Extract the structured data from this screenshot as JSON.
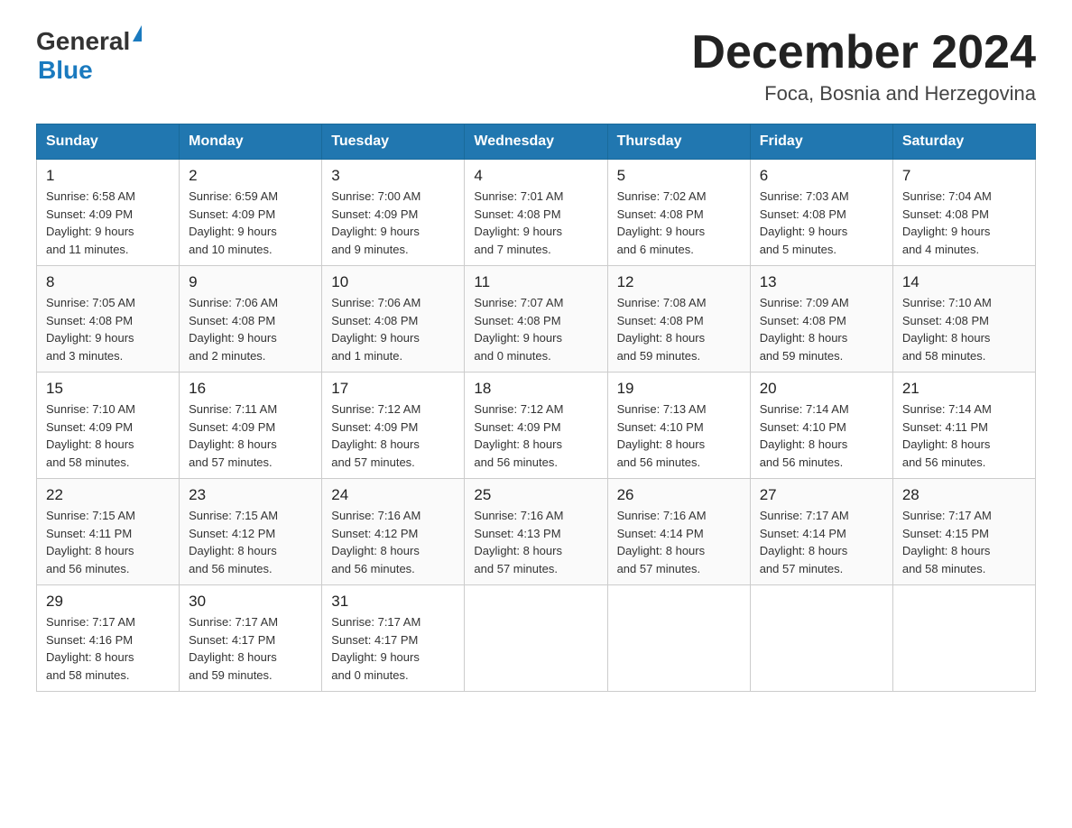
{
  "header": {
    "logo_general": "General",
    "logo_blue": "Blue",
    "month_title": "December 2024",
    "location": "Foca, Bosnia and Herzegovina"
  },
  "weekdays": [
    "Sunday",
    "Monday",
    "Tuesday",
    "Wednesday",
    "Thursday",
    "Friday",
    "Saturday"
  ],
  "weeks": [
    [
      {
        "day": "1",
        "sunrise": "6:58 AM",
        "sunset": "4:09 PM",
        "daylight": "9 hours and 11 minutes."
      },
      {
        "day": "2",
        "sunrise": "6:59 AM",
        "sunset": "4:09 PM",
        "daylight": "9 hours and 10 minutes."
      },
      {
        "day": "3",
        "sunrise": "7:00 AM",
        "sunset": "4:09 PM",
        "daylight": "9 hours and 9 minutes."
      },
      {
        "day": "4",
        "sunrise": "7:01 AM",
        "sunset": "4:08 PM",
        "daylight": "9 hours and 7 minutes."
      },
      {
        "day": "5",
        "sunrise": "7:02 AM",
        "sunset": "4:08 PM",
        "daylight": "9 hours and 6 minutes."
      },
      {
        "day": "6",
        "sunrise": "7:03 AM",
        "sunset": "4:08 PM",
        "daylight": "9 hours and 5 minutes."
      },
      {
        "day": "7",
        "sunrise": "7:04 AM",
        "sunset": "4:08 PM",
        "daylight": "9 hours and 4 minutes."
      }
    ],
    [
      {
        "day": "8",
        "sunrise": "7:05 AM",
        "sunset": "4:08 PM",
        "daylight": "9 hours and 3 minutes."
      },
      {
        "day": "9",
        "sunrise": "7:06 AM",
        "sunset": "4:08 PM",
        "daylight": "9 hours and 2 minutes."
      },
      {
        "day": "10",
        "sunrise": "7:06 AM",
        "sunset": "4:08 PM",
        "daylight": "9 hours and 1 minute."
      },
      {
        "day": "11",
        "sunrise": "7:07 AM",
        "sunset": "4:08 PM",
        "daylight": "9 hours and 0 minutes."
      },
      {
        "day": "12",
        "sunrise": "7:08 AM",
        "sunset": "4:08 PM",
        "daylight": "8 hours and 59 minutes."
      },
      {
        "day": "13",
        "sunrise": "7:09 AM",
        "sunset": "4:08 PM",
        "daylight": "8 hours and 59 minutes."
      },
      {
        "day": "14",
        "sunrise": "7:10 AM",
        "sunset": "4:08 PM",
        "daylight": "8 hours and 58 minutes."
      }
    ],
    [
      {
        "day": "15",
        "sunrise": "7:10 AM",
        "sunset": "4:09 PM",
        "daylight": "8 hours and 58 minutes."
      },
      {
        "day": "16",
        "sunrise": "7:11 AM",
        "sunset": "4:09 PM",
        "daylight": "8 hours and 57 minutes."
      },
      {
        "day": "17",
        "sunrise": "7:12 AM",
        "sunset": "4:09 PM",
        "daylight": "8 hours and 57 minutes."
      },
      {
        "day": "18",
        "sunrise": "7:12 AM",
        "sunset": "4:09 PM",
        "daylight": "8 hours and 56 minutes."
      },
      {
        "day": "19",
        "sunrise": "7:13 AM",
        "sunset": "4:10 PM",
        "daylight": "8 hours and 56 minutes."
      },
      {
        "day": "20",
        "sunrise": "7:14 AM",
        "sunset": "4:10 PM",
        "daylight": "8 hours and 56 minutes."
      },
      {
        "day": "21",
        "sunrise": "7:14 AM",
        "sunset": "4:11 PM",
        "daylight": "8 hours and 56 minutes."
      }
    ],
    [
      {
        "day": "22",
        "sunrise": "7:15 AM",
        "sunset": "4:11 PM",
        "daylight": "8 hours and 56 minutes."
      },
      {
        "day": "23",
        "sunrise": "7:15 AM",
        "sunset": "4:12 PM",
        "daylight": "8 hours and 56 minutes."
      },
      {
        "day": "24",
        "sunrise": "7:16 AM",
        "sunset": "4:12 PM",
        "daylight": "8 hours and 56 minutes."
      },
      {
        "day": "25",
        "sunrise": "7:16 AM",
        "sunset": "4:13 PM",
        "daylight": "8 hours and 57 minutes."
      },
      {
        "day": "26",
        "sunrise": "7:16 AM",
        "sunset": "4:14 PM",
        "daylight": "8 hours and 57 minutes."
      },
      {
        "day": "27",
        "sunrise": "7:17 AM",
        "sunset": "4:14 PM",
        "daylight": "8 hours and 57 minutes."
      },
      {
        "day": "28",
        "sunrise": "7:17 AM",
        "sunset": "4:15 PM",
        "daylight": "8 hours and 58 minutes."
      }
    ],
    [
      {
        "day": "29",
        "sunrise": "7:17 AM",
        "sunset": "4:16 PM",
        "daylight": "8 hours and 58 minutes."
      },
      {
        "day": "30",
        "sunrise": "7:17 AM",
        "sunset": "4:17 PM",
        "daylight": "8 hours and 59 minutes."
      },
      {
        "day": "31",
        "sunrise": "7:17 AM",
        "sunset": "4:17 PM",
        "daylight": "9 hours and 0 minutes."
      },
      null,
      null,
      null,
      null
    ]
  ],
  "labels": {
    "sunrise": "Sunrise:",
    "sunset": "Sunset:",
    "daylight": "Daylight:"
  }
}
